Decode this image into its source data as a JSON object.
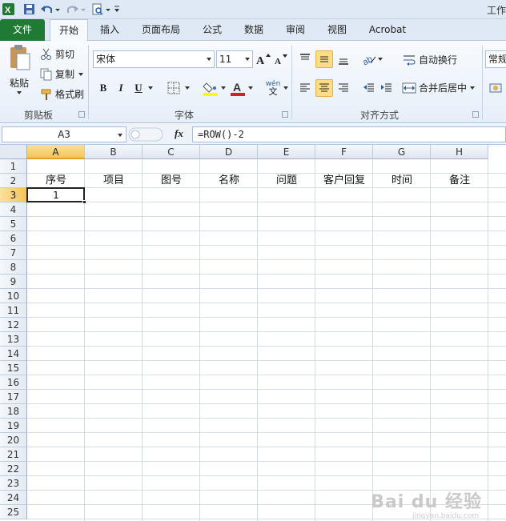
{
  "window": {
    "title": "工作"
  },
  "ribbon_tabs": [
    {
      "label": "文件"
    },
    {
      "label": "开始"
    },
    {
      "label": "插入"
    },
    {
      "label": "页面布局"
    },
    {
      "label": "公式"
    },
    {
      "label": "数据"
    },
    {
      "label": "审阅"
    },
    {
      "label": "视图"
    },
    {
      "label": "Acrobat"
    }
  ],
  "clipboard": {
    "paste": "粘贴",
    "cut": "剪切",
    "copy": "复制",
    "format_painter": "格式刷",
    "group_label": "剪贴板"
  },
  "font": {
    "font_name": "宋体",
    "font_size": "11",
    "bold": "B",
    "italic": "I",
    "underline": "U",
    "phonetic": "wén",
    "group_label": "字体"
  },
  "alignment": {
    "wrap_text": "自动换行",
    "merge_center": "合并后居中",
    "group_label": "对齐方式"
  },
  "number": {
    "format": "常规"
  },
  "formula_bar": {
    "name_box": "A3",
    "fx": "fx",
    "formula": "=ROW()-2"
  },
  "sheet": {
    "columns": [
      "A",
      "B",
      "C",
      "D",
      "E",
      "F",
      "G",
      "H"
    ],
    "rows": [
      "1",
      "2",
      "3",
      "4",
      "5",
      "6",
      "7",
      "8",
      "9",
      "10",
      "11",
      "12",
      "13",
      "14",
      "15",
      "16",
      "17",
      "18",
      "19",
      "20",
      "21",
      "22",
      "23",
      "24",
      "25"
    ],
    "headers_row2": [
      "序号",
      "项目",
      "图号",
      "名称",
      "问题",
      "客户回复",
      "时间",
      "备注"
    ],
    "a3_value": "1",
    "selected_column": "A",
    "selected_row": "3"
  },
  "watermark": {
    "main": "Bai du 经验",
    "sub": "jingyan.baidu.com"
  },
  "colors": {
    "file_tab": "#1f7a33",
    "selection": "#f4c45a",
    "grid_line": "#d7dde6"
  }
}
